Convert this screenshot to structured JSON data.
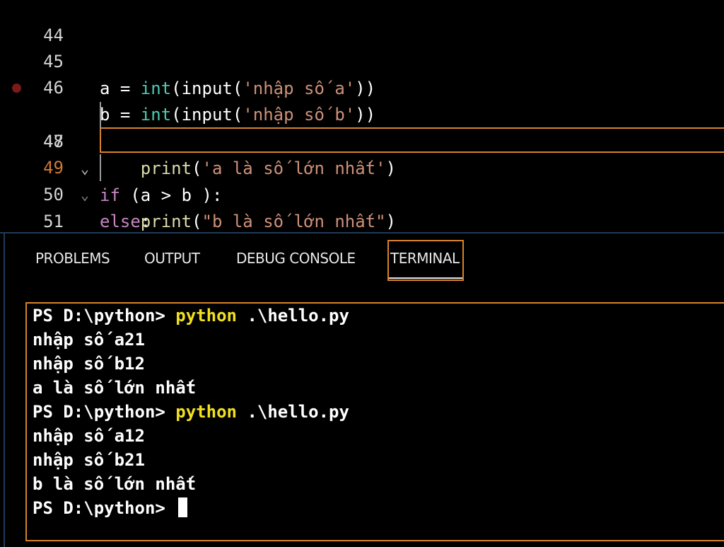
{
  "editor": {
    "lines": [
      {
        "number": "44"
      },
      {
        "number": "45",
        "tokens": [
          {
            "text": "a = ",
            "kind": "plain"
          },
          {
            "text": "int",
            "kind": "func"
          },
          {
            "text": "(",
            "kind": "plain"
          },
          {
            "text": "input",
            "kind": "plain"
          },
          {
            "text": "(",
            "kind": "plain"
          },
          {
            "text": "'nhập số a'",
            "kind": "str"
          },
          {
            "text": "))",
            "kind": "plain"
          }
        ]
      },
      {
        "number": "46",
        "tokens": [
          {
            "text": "b = ",
            "kind": "plain"
          },
          {
            "text": "int",
            "kind": "func"
          },
          {
            "text": "(",
            "kind": "plain"
          },
          {
            "text": "input",
            "kind": "plain"
          },
          {
            "text": "(",
            "kind": "plain"
          },
          {
            "text": "'nhập số b'",
            "kind": "str"
          },
          {
            "text": "))",
            "kind": "plain"
          }
        ]
      },
      {
        "number": "47",
        "tokens": [
          {
            "text": "if",
            "kind": "kw"
          },
          {
            "text": " (a > b ):",
            "kind": "plain"
          }
        ]
      },
      {
        "number": "48",
        "tokens": [
          {
            "text": "    ",
            "kind": "plain"
          },
          {
            "text": "print",
            "kind": "call"
          },
          {
            "text": "(",
            "kind": "plain"
          },
          {
            "text": "'a là số lớn nhất'",
            "kind": "str"
          },
          {
            "text": ")",
            "kind": "plain"
          }
        ]
      },
      {
        "number": "49",
        "tokens": [
          {
            "text": "else",
            "kind": "kw"
          },
          {
            "text": ":",
            "kind": "plain"
          }
        ]
      },
      {
        "number": "50",
        "tokens": [
          {
            "text": "    ",
            "kind": "plain"
          },
          {
            "text": "print",
            "kind": "call"
          },
          {
            "text": "(",
            "kind": "plain"
          },
          {
            "text": "\"b là số lớn nhất\"",
            "kind": "str"
          },
          {
            "text": ")",
            "kind": "plain"
          }
        ]
      },
      {
        "number": "51"
      }
    ],
    "fold_icon": "chevron-down-icon",
    "breakpoint_color": "#7a1a1a"
  },
  "panel": {
    "tabs": [
      "PROBLEMS",
      "OUTPUT",
      "DEBUG CONSOLE",
      "TERMINAL"
    ],
    "active_tab": "TERMINAL"
  },
  "terminal": {
    "lines": [
      {
        "prompt": "PS D:\\python> ",
        "command": "python",
        "args": " .\\hello.py"
      },
      {
        "text": "nhập số a21"
      },
      {
        "text": "nhập số b12"
      },
      {
        "text": "a là số lớn nhất"
      },
      {
        "prompt": "PS D:\\python> ",
        "command": "python",
        "args": " .\\hello.py"
      },
      {
        "text": "nhập số a12"
      },
      {
        "text": "nhập số b21"
      },
      {
        "text": "b là số lớn nhất"
      },
      {
        "prompt": "PS D:\\python> "
      }
    ]
  },
  "colors": {
    "accent_orange": "#d9822b",
    "command_yellow": "#f2e01e",
    "string": "#ce9178",
    "keyword": "#c586c0",
    "builtin": "#4ec9b0",
    "function": "#dcdcaa"
  }
}
